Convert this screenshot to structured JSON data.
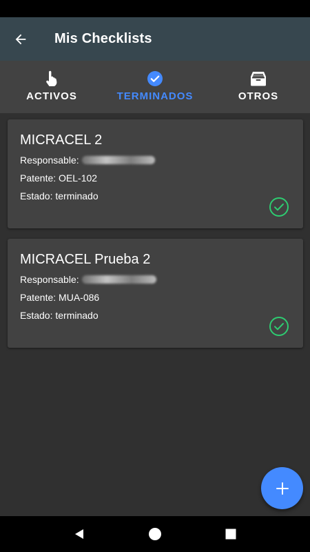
{
  "app_bar": {
    "title": "Mis Checklists",
    "back_icon": "arrow-back-icon"
  },
  "tabs": [
    {
      "label": "ACTIVOS",
      "icon": "hand-pointer-icon",
      "active": false
    },
    {
      "label": "TERMINADOS",
      "icon": "check-circle-icon",
      "active": true
    },
    {
      "label": "OTROS",
      "icon": "archive-box-icon",
      "active": false
    }
  ],
  "cards": [
    {
      "title": "MICRACEL 2",
      "responsable_label": "Responsable:",
      "patente": "Patente: OEL-102",
      "estado": "Estado: terminado",
      "status_icon": "check-circle-outline-icon"
    },
    {
      "title": "MICRACEL Prueba 2",
      "responsable_label": "Responsable:",
      "patente": "Patente: MUA-086",
      "estado": "Estado: terminado",
      "status_icon": "check-circle-outline-icon"
    }
  ],
  "fab": {
    "icon": "plus-icon"
  },
  "nav": {
    "back_icon": "nav-back-icon",
    "home_icon": "nav-home-icon",
    "recents_icon": "nav-recents-icon"
  },
  "colors": {
    "app_bar": "#37474f",
    "background": "#303030",
    "card": "#424242",
    "accent": "#448aff",
    "success": "#2ecc71"
  }
}
